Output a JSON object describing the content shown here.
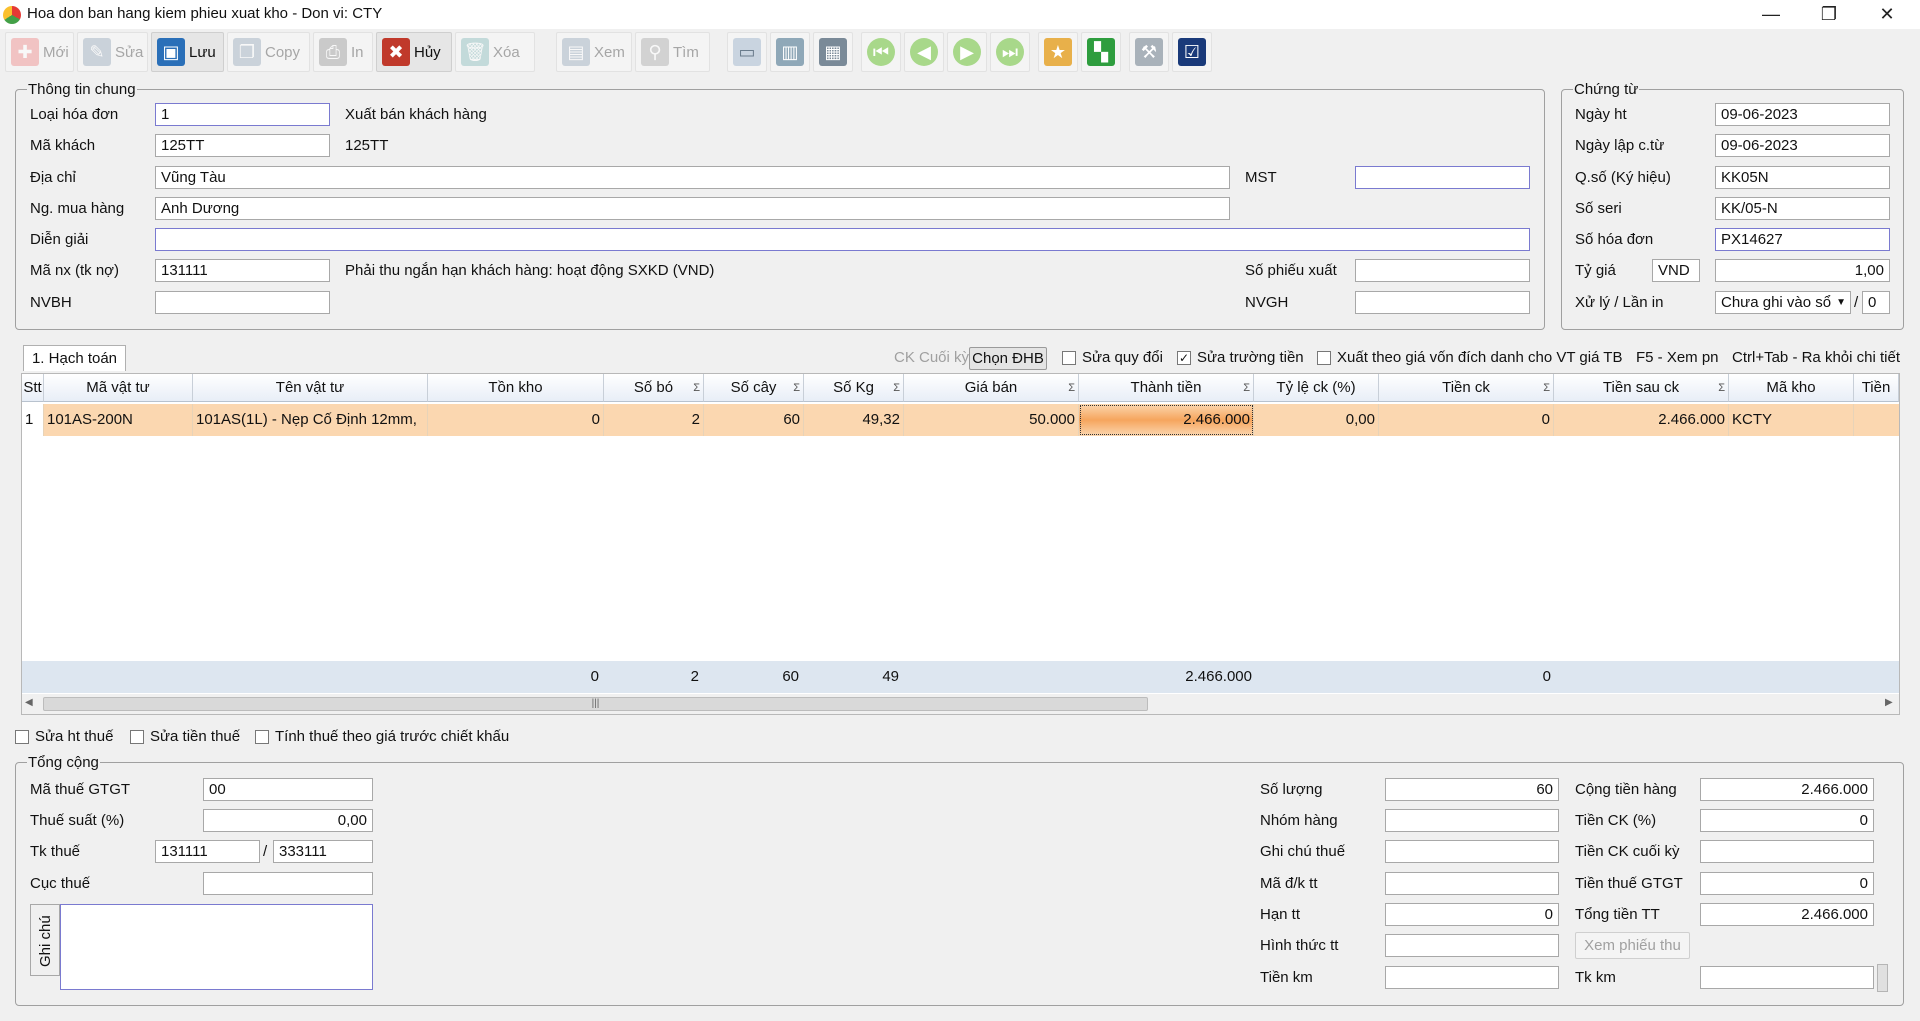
{
  "window": {
    "title": "Hoa don ban hang kiem phieu xuat kho - Don vi: CTY",
    "minimize": "—",
    "restore": "❐",
    "close": "✕"
  },
  "toolbar": {
    "moi": "Mới",
    "sua": "Sửa",
    "luu": "Lưu",
    "copy": "Copy",
    "in": "In",
    "huy": "Hủy",
    "xoa": "Xóa",
    "xem": "Xem",
    "tim": "Tìm"
  },
  "general": {
    "legend": "Thông tin chung",
    "loai_hd": {
      "label": "Loại hóa đơn",
      "value": "1",
      "desc": "Xuất bán khách hàng"
    },
    "ma_khach": {
      "label": "Mã khách",
      "value": "125TT",
      "desc": "125TT"
    },
    "dia_chi": {
      "label": "Địa chỉ",
      "value": "Vũng Tàu"
    },
    "mst": {
      "label": "MST",
      "value": ""
    },
    "ng_mua": {
      "label": "Ng. mua hàng",
      "value": "Anh Dương"
    },
    "dien_giai": {
      "label": "Diễn giải",
      "value": ""
    },
    "ma_nx": {
      "label": "Mã nx (tk nợ)",
      "value": "131111",
      "desc": "Phải thu ngắn hạn khách hàng: hoạt động SXKD (VND)"
    },
    "so_phieu": {
      "label": "Số phiếu xuất",
      "value": ""
    },
    "nvbh": {
      "label": "NVBH",
      "value": ""
    },
    "nvgh": {
      "label": "NVGH",
      "value": ""
    }
  },
  "voucher": {
    "legend": "Chứng từ",
    "ngay_ht": {
      "label": "Ngày ht",
      "value": "09-06-2023"
    },
    "ngay_lap": {
      "label": "Ngày lập c.từ",
      "value": "09-06-2023"
    },
    "qso": {
      "label": "Q.số (Ký hiệu)",
      "value": "KK05N"
    },
    "seri": {
      "label": "Số seri",
      "value": "KK/05-N"
    },
    "so_hd": {
      "label": "Số hóa đơn",
      "value": "PX14627"
    },
    "ty_gia": {
      "label": "Tỷ giá",
      "currency": "VND",
      "value": "1,00"
    },
    "xu_ly": {
      "label": "Xử lý / Lần in",
      "value": "Chưa ghi vào sổ",
      "sep": "/",
      "lan_in": "0"
    }
  },
  "tab": {
    "label": "1. Hạch toán"
  },
  "gridbar": {
    "ck_cuoi_ky": "CK Cuối kỳ",
    "chon_dhb": "Chọn ĐHB",
    "sua_quy_doi": "Sửa quy đổi",
    "sua_truong_tien": "Sửa trường tiền",
    "xuat_theo_gia": "Xuất theo giá vốn đích danh cho VT giá TB",
    "hint1": "F5 - Xem pn",
    "hint2": "Ctrl+Tab - Ra khỏi chi tiết"
  },
  "grid": {
    "headers": [
      "Stt",
      "Mã vật tư",
      "Tên vật tư",
      "Tồn kho",
      "Số bó",
      "Số cây",
      "Số Kg",
      "Giá bán",
      "Thành tiền",
      "Tỷ lệ ck (%)",
      "Tiền ck",
      "Tiền sau ck",
      "Mã kho",
      "Tiền"
    ],
    "row": {
      "stt": "1",
      "ma_vt": "101AS-200N",
      "ten_vt": "101AS(1L) - Nẹp Cố Định 12mm,",
      "ton_kho": "0",
      "so_bo": "2",
      "so_cay": "60",
      "so_kg": "49,32",
      "gia_ban": "50.000",
      "thanh_tien": "2.466.000",
      "ty_le_ck": "0,00",
      "tien_ck": "0",
      "tien_sau_ck": "2.466.000",
      "ma_kho": "KCTY"
    },
    "footer": {
      "ton_kho": "0",
      "so_bo": "2",
      "so_cay": "60",
      "so_kg": "49",
      "thanh_tien": "2.466.000",
      "tien_ck": "0"
    },
    "sigma": "Σ"
  },
  "options": {
    "sua_ht_thue": "Sửa ht thuế",
    "sua_tien_thue": "Sửa tiền thuế",
    "tinh_thue": "Tính thuế theo giá trước chiết khấu"
  },
  "totals": {
    "legend": "Tổng cộng",
    "ma_thue": {
      "label": "Mã thuế GTGT",
      "value": "00"
    },
    "thue_suat": {
      "label": "Thuế suất (%)",
      "value": "0,00"
    },
    "tk_thue": {
      "label": "Tk thuế",
      "value1": "131111",
      "sep": "/",
      "value2": "333111"
    },
    "cuc_thue": {
      "label": "Cục thuế",
      "value": ""
    },
    "ghi_chu": {
      "label": "Ghi chú",
      "value": ""
    },
    "so_luong": {
      "label": "Số lượng",
      "value": "60"
    },
    "nhom_hang": {
      "label": "Nhóm hàng",
      "value": ""
    },
    "ghi_chu_thue": {
      "label": "Ghi chú thuế",
      "value": ""
    },
    "ma_dk_tt": {
      "label": "Mã đ/k tt",
      "value": ""
    },
    "han_tt": {
      "label": "Hạn tt",
      "value": "0"
    },
    "hinh_thuc_tt": {
      "label": "Hình thức tt",
      "value": ""
    },
    "tien_km": {
      "label": "Tiền km",
      "value": ""
    },
    "cong_tien_hang": {
      "label": "Cộng tiền hàng",
      "value": "2.466.000"
    },
    "tien_ck_pct": {
      "label": "Tiền CK (%)",
      "value": "0"
    },
    "tien_ck_cuoi_ky": {
      "label": "Tiền CK cuối kỳ",
      "value": ""
    },
    "tien_thue": {
      "label": "Tiền thuế GTGT",
      "value": "0"
    },
    "tong_tien_tt": {
      "label": "Tổng tiền TT",
      "value": "2.466.000"
    },
    "xem_phieu_thu": "Xem phiếu thu",
    "tk_km": {
      "label": "Tk km",
      "value": ""
    }
  },
  "colors": {
    "row_highlight": "#fbd7b0",
    "cell_focus": "#f6a55d",
    "footer": "#dde6f0"
  }
}
